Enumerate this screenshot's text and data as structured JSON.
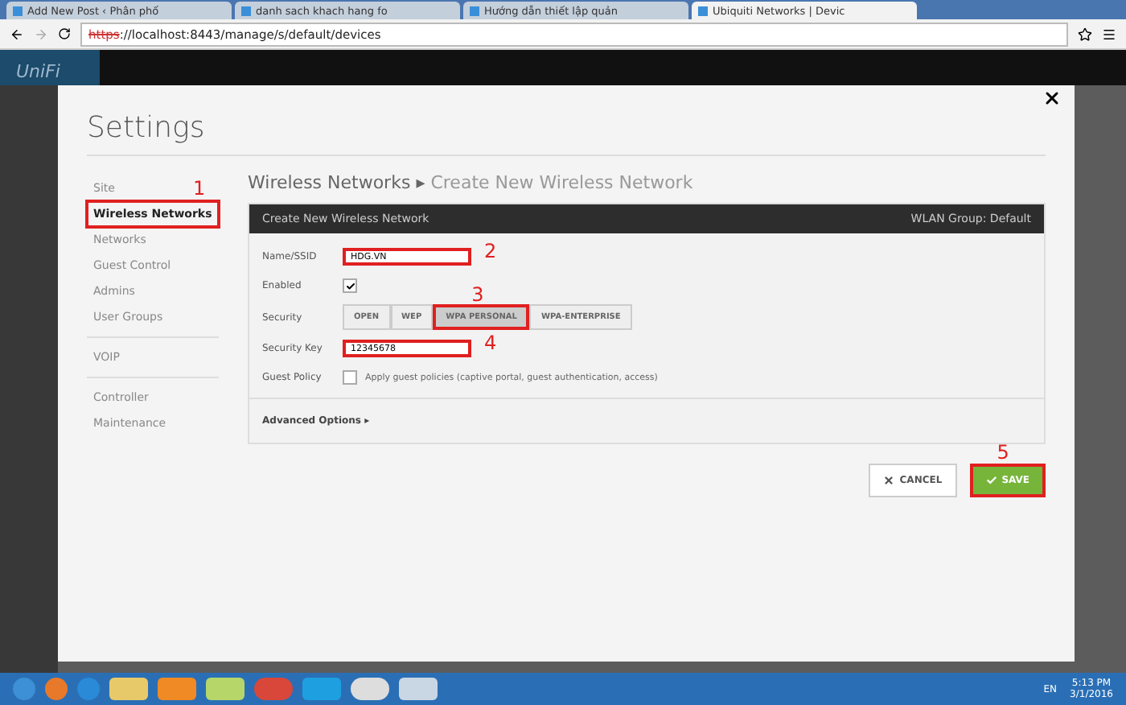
{
  "browser": {
    "tabs": [
      {
        "title": "Add New Post ‹ Phân phố",
        "selected": false
      },
      {
        "title": "danh sach khach hang fo",
        "selected": false
      },
      {
        "title": "Hướng dẫn thiết lập quản",
        "selected": false
      },
      {
        "title": "Ubiquiti Networks | Devic",
        "selected": true
      }
    ],
    "address": {
      "scheme": "https",
      "rest": "://localhost:8443/manage/s/default/devices"
    }
  },
  "app": {
    "logo": "UniFi"
  },
  "settings": {
    "title": "Settings",
    "sidebar": [
      [
        {
          "label": "Site",
          "selected": false
        },
        {
          "label": "Wireless Networks",
          "selected": true,
          "annotation": "1"
        },
        {
          "label": "Networks",
          "selected": false
        },
        {
          "label": "Guest Control",
          "selected": false
        },
        {
          "label": "Admins",
          "selected": false
        },
        {
          "label": "User Groups",
          "selected": false
        }
      ],
      [
        {
          "label": "VOIP",
          "selected": false
        }
      ],
      [
        {
          "label": "Controller",
          "selected": false
        },
        {
          "label": "Maintenance",
          "selected": false
        }
      ]
    ],
    "breadcrumb": {
      "parent": "Wireless Networks",
      "separator": "▸",
      "current": "Create New Wireless Network"
    },
    "panel": {
      "title": "Create New Wireless Network",
      "group": "WLAN Group: Default",
      "rows": [
        {
          "kind": "text",
          "label": "Name/SSID",
          "value": "HDG.VN",
          "annotation": "2"
        },
        {
          "kind": "check",
          "label": "Enabled",
          "checked": true
        },
        {
          "kind": "segments",
          "label": "Security",
          "options": [
            {
              "label": "OPEN",
              "selected": false
            },
            {
              "label": "WEP",
              "selected": false
            },
            {
              "label": "WPA PERSONAL",
              "selected": true,
              "annotation": "3"
            },
            {
              "label": "WPA-ENTERPRISE",
              "selected": false
            }
          ]
        },
        {
          "kind": "text",
          "label": "Security Key",
          "value": "12345678",
          "annotation": "4"
        },
        {
          "kind": "check",
          "label": "Guest Policy",
          "checked": false,
          "text": "Apply guest policies (captive portal, guest authentication, access)"
        }
      ],
      "advanced": "Advanced Options",
      "advanced_arrow": "▸"
    },
    "buttons": [
      {
        "kind": "cancel",
        "label": "CANCEL"
      },
      {
        "kind": "save",
        "label": "SAVE",
        "annotation": "5"
      }
    ]
  },
  "taskbar": {
    "language": "EN",
    "time": "5:13 PM",
    "date": "3/1/2016"
  }
}
